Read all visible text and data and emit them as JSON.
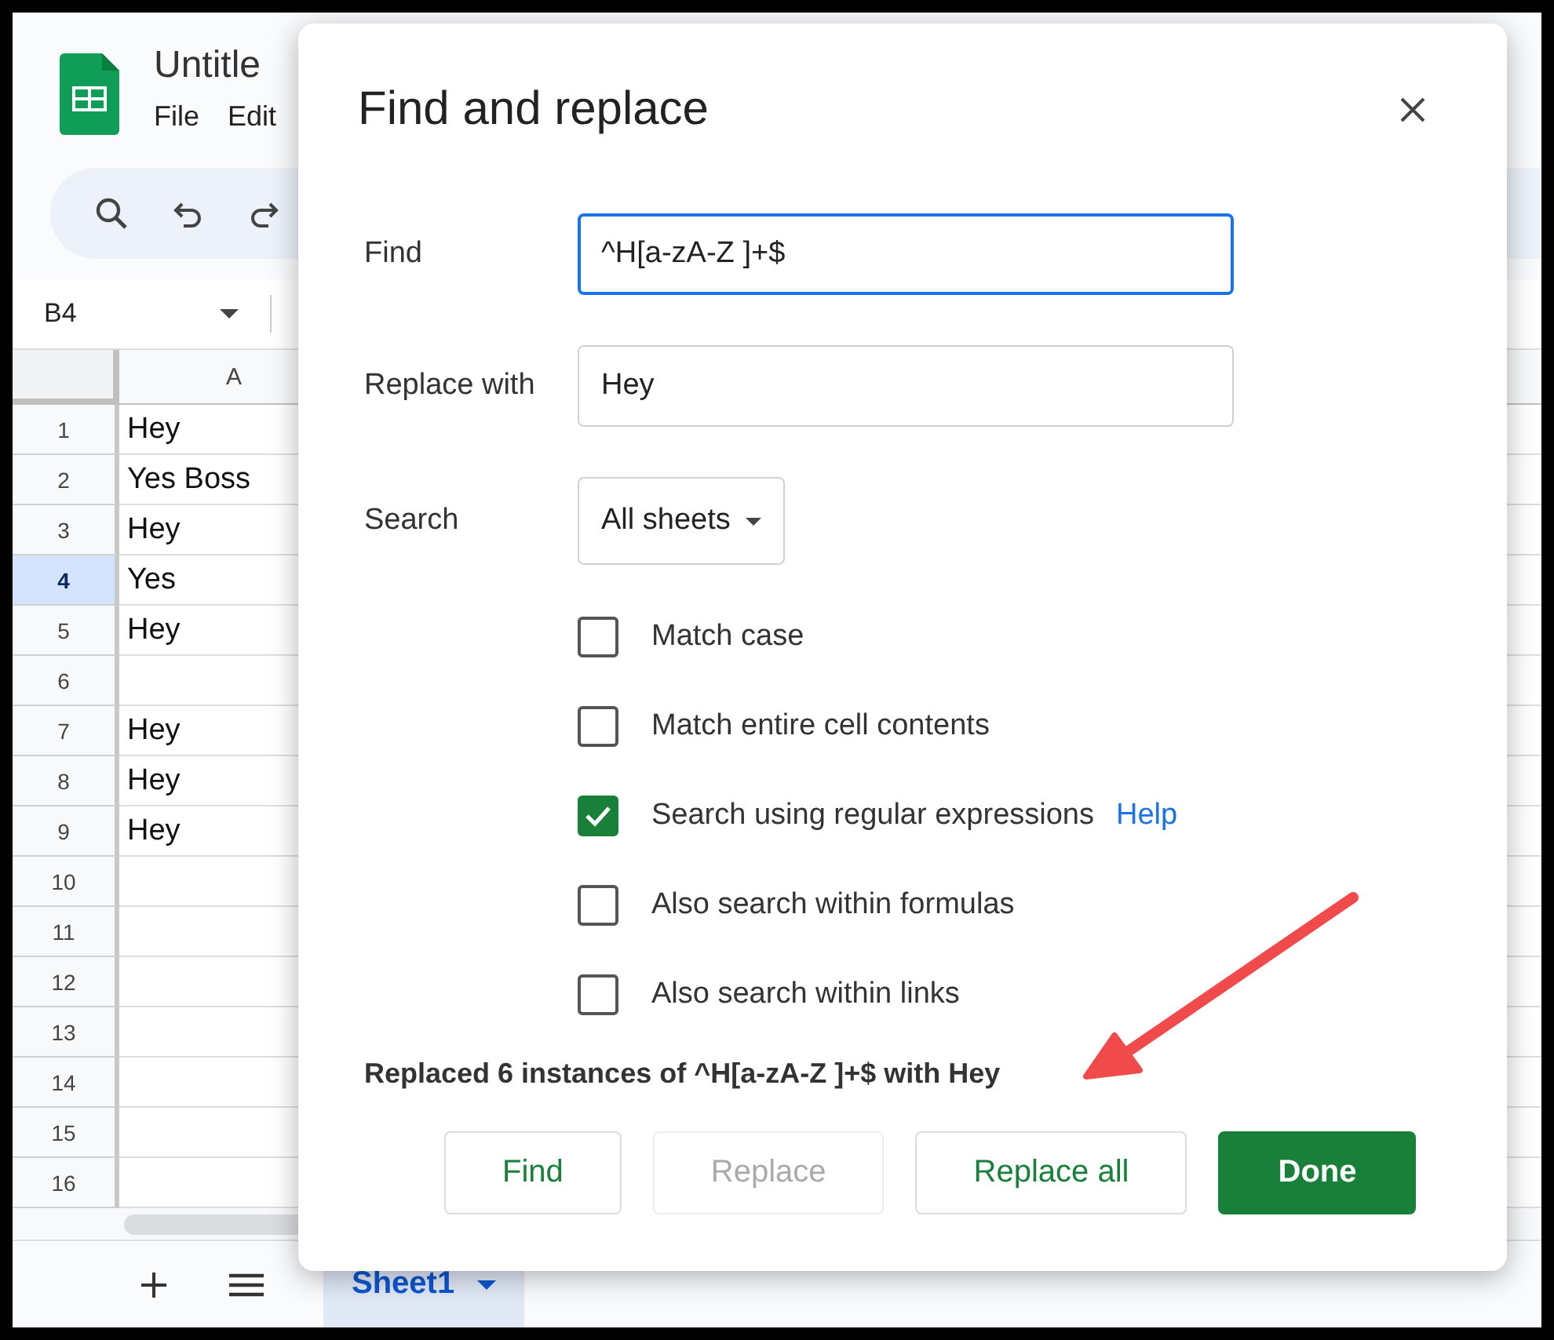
{
  "app": {
    "title": "Untitle",
    "menu": [
      "File",
      "Edit"
    ],
    "name_box": "B4"
  },
  "sheet": {
    "column_header": "A",
    "rows": [
      {
        "number": "1",
        "cell": "Hey",
        "selected": false
      },
      {
        "number": "2",
        "cell": "Yes Boss",
        "selected": false
      },
      {
        "number": "3",
        "cell": "Hey",
        "selected": false
      },
      {
        "number": "4",
        "cell": "Yes",
        "selected": true
      },
      {
        "number": "5",
        "cell": "Hey",
        "selected": false
      },
      {
        "number": "6",
        "cell": "",
        "selected": false
      },
      {
        "number": "7",
        "cell": "Hey",
        "selected": false
      },
      {
        "number": "8",
        "cell": "Hey",
        "selected": false
      },
      {
        "number": "9",
        "cell": "Hey",
        "selected": false
      },
      {
        "number": "10",
        "cell": "",
        "selected": false
      },
      {
        "number": "11",
        "cell": "",
        "selected": false
      },
      {
        "number": "12",
        "cell": "",
        "selected": false
      },
      {
        "number": "13",
        "cell": "",
        "selected": false
      },
      {
        "number": "14",
        "cell": "",
        "selected": false
      },
      {
        "number": "15",
        "cell": "",
        "selected": false
      },
      {
        "number": "16",
        "cell": "",
        "selected": false
      }
    ]
  },
  "sheet_tabs": [
    {
      "label": "Sheet1",
      "selected": true
    }
  ],
  "dialog": {
    "title": "Find and replace",
    "fields": [
      {
        "label": "Find",
        "value": "^H[a-zA-Z ]+$",
        "focused": true
      },
      {
        "label": "Replace with",
        "value": "Hey",
        "focused": false
      }
    ],
    "search": {
      "label": "Search",
      "value": "All sheets"
    },
    "options": [
      {
        "label": "Match case",
        "checked": false
      },
      {
        "label": "Match entire cell contents",
        "checked": false
      },
      {
        "label": "Search using regular expressions",
        "checked": true,
        "link": "Help"
      },
      {
        "label": "Also search within formulas",
        "checked": false
      },
      {
        "label": "Also search within links",
        "checked": false
      }
    ],
    "message": "Replaced 6 instances of ^H[a-zA-Z ]+$ with Hey",
    "buttons": [
      {
        "label": "Find",
        "kind": "outline",
        "disabled": false
      },
      {
        "label": "Replace",
        "kind": "outline",
        "disabled": true
      },
      {
        "label": "Replace all",
        "kind": "outline",
        "disabled": false
      },
      {
        "label": "Done",
        "kind": "primary",
        "disabled": false
      }
    ]
  }
}
